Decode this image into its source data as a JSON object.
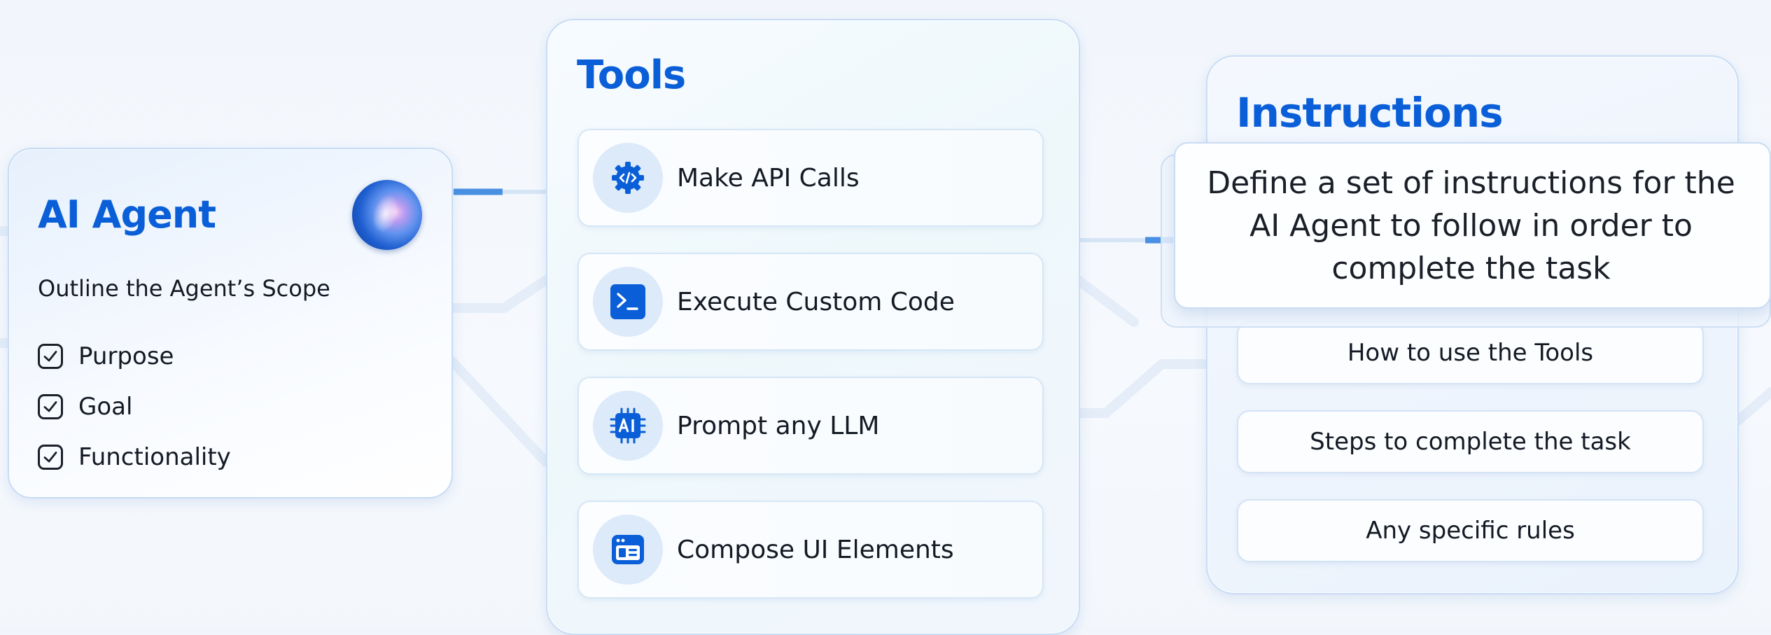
{
  "agent": {
    "title": "AI Agent",
    "orb_icon": "ai-agent-orb-icon",
    "subtitle": "Outline the Agent’s Scope",
    "checklist": [
      {
        "label": "Purpose",
        "checked": true
      },
      {
        "label": "Goal",
        "checked": true
      },
      {
        "label": "Functionality",
        "checked": true
      }
    ]
  },
  "tools": {
    "title": "Tools",
    "items": [
      {
        "label": "Make API Calls",
        "icon": "api-gear-icon"
      },
      {
        "label": "Execute Custom Code",
        "icon": "terminal-icon"
      },
      {
        "label": "Prompt any LLM",
        "icon": "ai-chip-icon"
      },
      {
        "label": "Compose UI Elements",
        "icon": "ui-window-icon"
      }
    ]
  },
  "instructions": {
    "title": "Instructions",
    "tooltip": "Define a set of instructions for the AI Agent to follow in order to complete the task",
    "items": [
      {
        "label": "How to use the Tools"
      },
      {
        "label": "Steps to complete the task"
      },
      {
        "label": "Any specific rules"
      }
    ]
  },
  "colors": {
    "accent": "#0a5fd8",
    "icon_bg": "#dceafa",
    "card_border": "#c7dcf5",
    "connector": "#4a90e2"
  }
}
